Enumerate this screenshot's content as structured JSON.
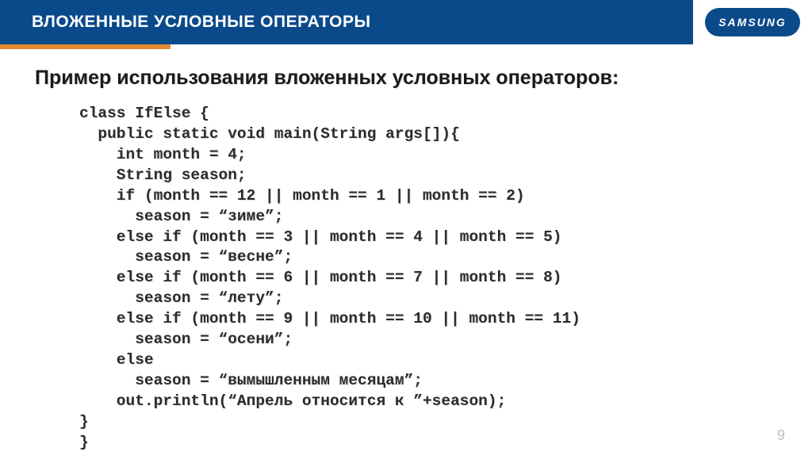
{
  "header": {
    "title": "ВЛОЖЕННЫЕ УСЛОВНЫЕ ОПЕРАТОРЫ",
    "logo_text": "SAMSUNG"
  },
  "subtitle": "Пример использования вложенных условных операторов:",
  "code": "class IfElse {\n  public static void main(String args[]){\n    int month = 4;\n    String season;\n    if (month == 12 || month == 1 || month == 2)\n      season = “зиме”;\n    else if (month == 3 || month == 4 || month == 5)\n      season = “весне”;\n    else if (month == 6 || month == 7 || month == 8)\n      season = “лету”;\n    else if (month == 9 || month == 10 || month == 11)\n      season = “осени”;\n    else\n      season = “вымышленным месяцам”;\n    out.println(“Апрель относится к ”+season);\n}\n}",
  "page_number": "9"
}
